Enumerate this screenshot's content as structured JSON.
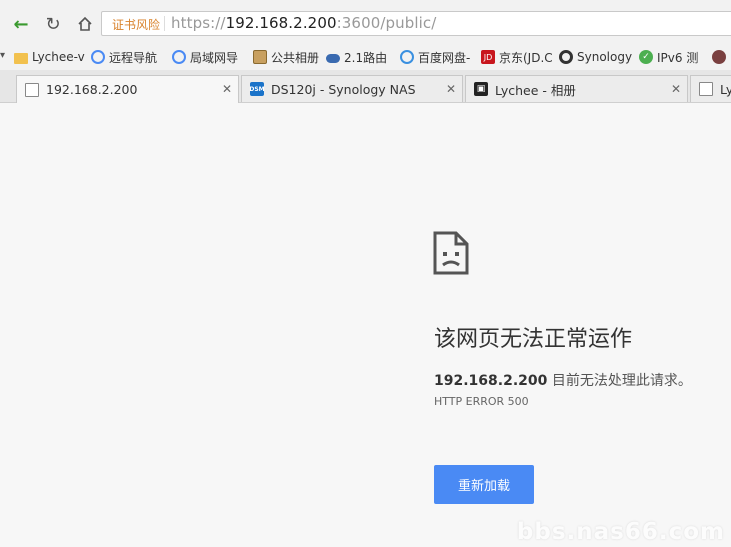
{
  "toolbar": {
    "cert_warning": "证书风险",
    "url_scheme": "https://",
    "url_host": "192.168.2.200",
    "url_rest": ":3600/public/"
  },
  "bookmarks": [
    {
      "label": "Lychee-v",
      "icon": "folder-icon",
      "color": "#f2c14e"
    },
    {
      "label": "远程导航",
      "icon": "cloud-icon",
      "color": "#4a8af4"
    },
    {
      "label": "局域网导",
      "icon": "cloud-icon",
      "color": "#4a8af4"
    },
    {
      "label": "公共相册",
      "icon": "photo-icon",
      "color": "#c8a060"
    },
    {
      "label": "2.1路由",
      "icon": "eye-icon",
      "color": "#3a6ab0"
    },
    {
      "label": "百度网盘-",
      "icon": "baidu-icon",
      "color": "#3a90e0"
    },
    {
      "label": "京东(JD.C",
      "icon": "jd-icon",
      "color": "#c8161d"
    },
    {
      "label": "Synology",
      "icon": "synology-icon",
      "color": "#333333"
    },
    {
      "label": "IPv6 测",
      "icon": "check-icon",
      "color": "#4caf50"
    }
  ],
  "tabs": [
    {
      "title": "192.168.2.200",
      "icon": "page-icon",
      "active": true
    },
    {
      "title": "DS120j - Synology NAS",
      "icon": "dsm-icon",
      "active": false
    },
    {
      "title": "Lychee - 相册",
      "icon": "lychee-icon",
      "active": false
    },
    {
      "title": "Lyc",
      "icon": "page-icon",
      "active": false
    }
  ],
  "error": {
    "icon": "sad-page-icon",
    "title": "该网页无法正常运作",
    "host": "192.168.2.200",
    "message": " 目前无法处理此请求。",
    "code": "HTTP ERROR 500",
    "reload_label": "重新加载"
  },
  "watermark": "bbs.nas66.com",
  "colors": {
    "accent_button": "#4a8af4",
    "cert_warning": "#d9822b"
  }
}
